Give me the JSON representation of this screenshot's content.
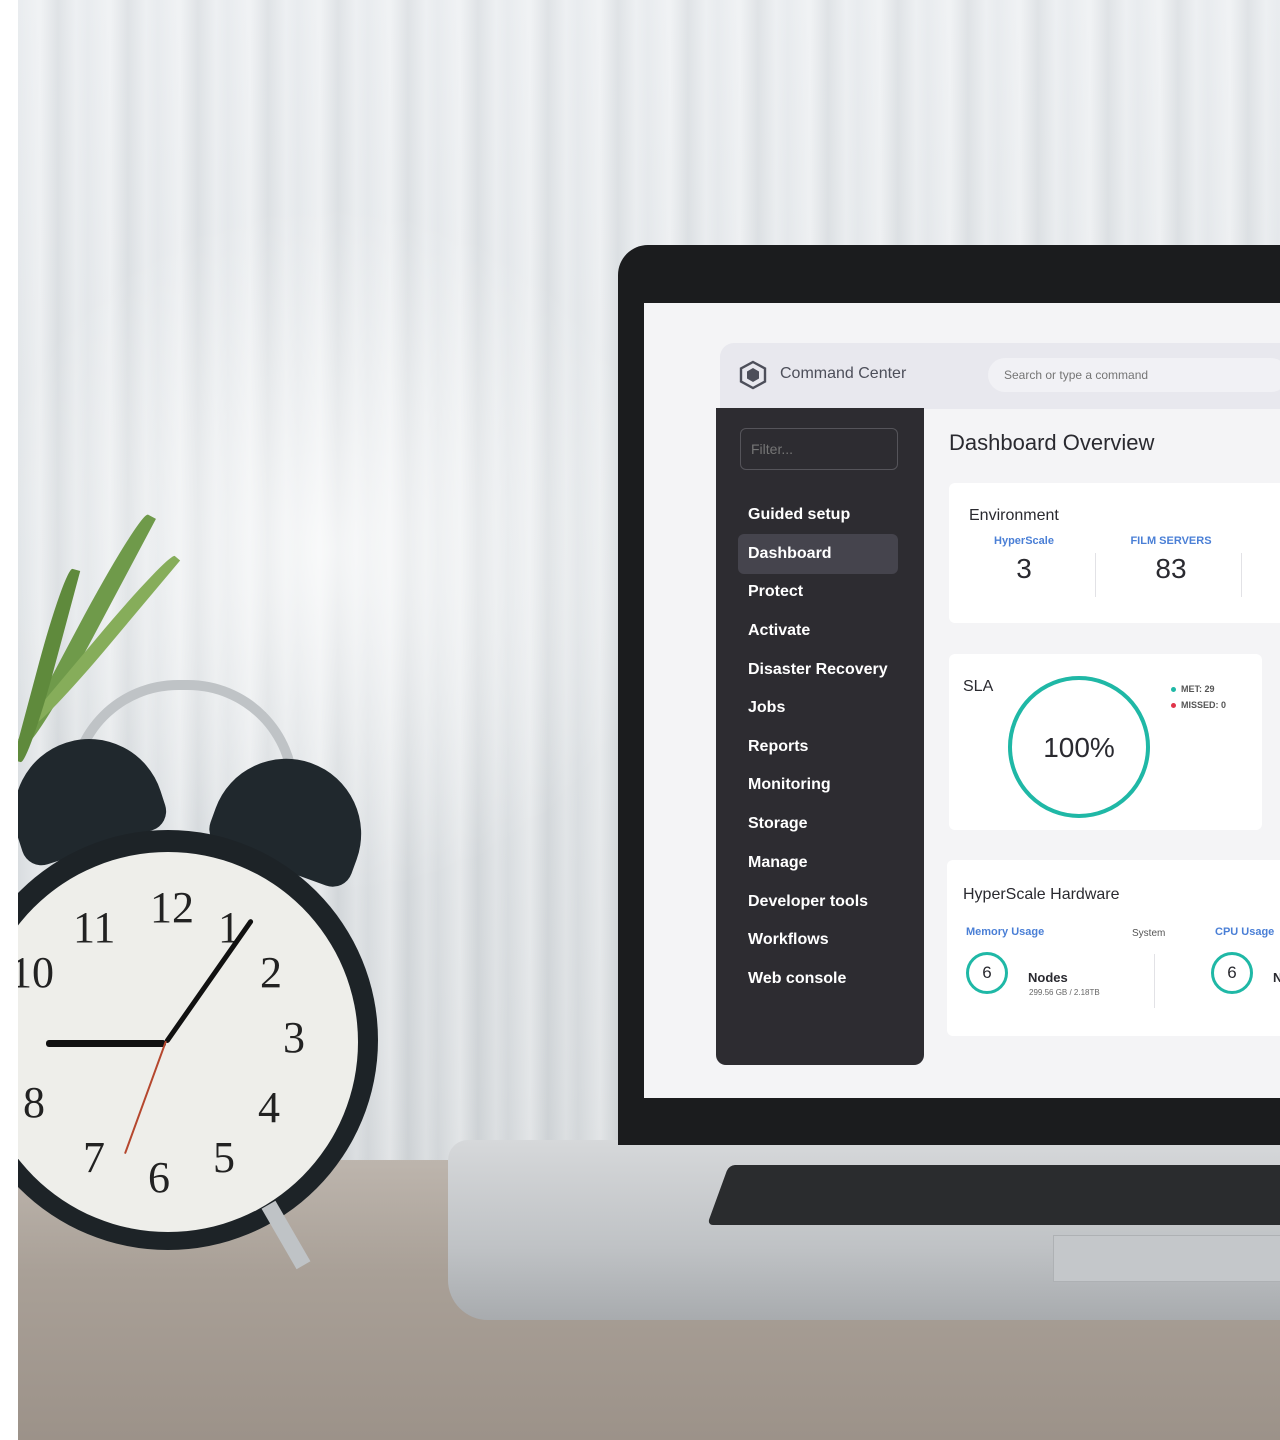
{
  "app": {
    "name": "Command Center",
    "search_placeholder": "Search or type a command"
  },
  "sidebar": {
    "filter_placeholder": "Filter...",
    "items": [
      {
        "label": "Guided setup",
        "active": false
      },
      {
        "label": "Dashboard",
        "active": true
      },
      {
        "label": "Protect",
        "active": false
      },
      {
        "label": "Activate",
        "active": false
      },
      {
        "label": "Disaster Recovery",
        "active": false
      },
      {
        "label": "Jobs",
        "active": false
      },
      {
        "label": "Reports",
        "active": false
      },
      {
        "label": "Monitoring",
        "active": false
      },
      {
        "label": "Storage",
        "active": false
      },
      {
        "label": "Manage",
        "active": false
      },
      {
        "label": "Developer tools",
        "active": false
      },
      {
        "label": "Workflows",
        "active": false
      },
      {
        "label": "Web console",
        "active": false
      }
    ]
  },
  "main": {
    "title": "Dashboard Overview",
    "environment": {
      "title": "Environment",
      "stats": [
        {
          "label": "HyperScale",
          "value": "3"
        },
        {
          "label": "FILM SERVERS",
          "value": "83"
        }
      ]
    },
    "sla": {
      "title": "SLA",
      "percent_label": "100%",
      "percent": 100,
      "met_label": "MET: 29",
      "missed_label": "MISSED: 0"
    },
    "hardware": {
      "title": "HyperScale Hardware",
      "memory_label": "Memory Usage",
      "system_label": "System",
      "cpu_label": "CPU Usage",
      "memory_nodes": "6",
      "nodes_label": "Nodes",
      "memory_detail": "299.56 GB / 2.18TB",
      "cpu_nodes": "6",
      "cpu_nodes_label_partial": "N"
    }
  },
  "colors": {
    "accent_teal": "#1fb8a6",
    "accent_blue": "#4a7fd6",
    "met_dot": "#1fb8a6",
    "missed_dot": "#e0344a",
    "sidebar_bg": "#2d2c31"
  },
  "clock": {
    "numerals": [
      "12",
      "1",
      "2",
      "3",
      "4",
      "5",
      "6",
      "7",
      "8",
      "10",
      "11"
    ]
  }
}
